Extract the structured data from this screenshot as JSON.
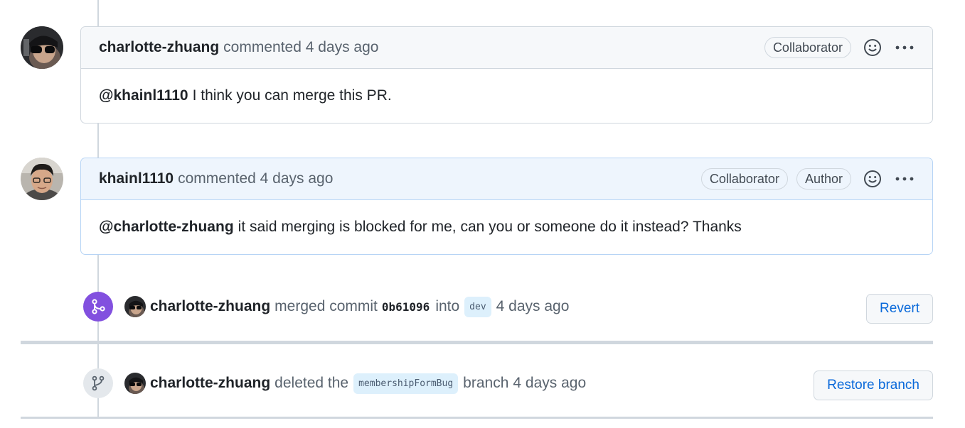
{
  "comments": [
    {
      "user": "charlotte-zhuang",
      "meta": "commented 4 days ago",
      "badges": [
        "Collaborator"
      ],
      "mention": "@khainl1110",
      "text": "I think you can merge this PR."
    },
    {
      "user": "khainl1110",
      "meta": "commented 4 days ago",
      "badges": [
        "Collaborator",
        "Author"
      ],
      "mention": "@charlotte-zhuang",
      "text": "it said merging is blocked for me, can you or someone do it instead? Thanks"
    }
  ],
  "events": {
    "merged": {
      "user": "charlotte-zhuang",
      "action": "merged commit",
      "sha": "0b61096",
      "into": "into",
      "branch": "dev",
      "time": "4 days ago",
      "button": "Revert"
    },
    "deleted": {
      "user": "charlotte-zhuang",
      "action": "deleted the",
      "branch": "membershipFormBug",
      "suffix": "branch",
      "time": "4 days ago",
      "button": "Restore branch"
    }
  },
  "colors": {
    "merged_badge": "#8250df",
    "link_blue": "#0969da",
    "border": "#d0d7de"
  },
  "icons": {
    "reaction": "smiley-icon",
    "menu": "kebab-horizontal-icon",
    "merge": "git-merge-icon",
    "branch": "git-branch-icon"
  }
}
